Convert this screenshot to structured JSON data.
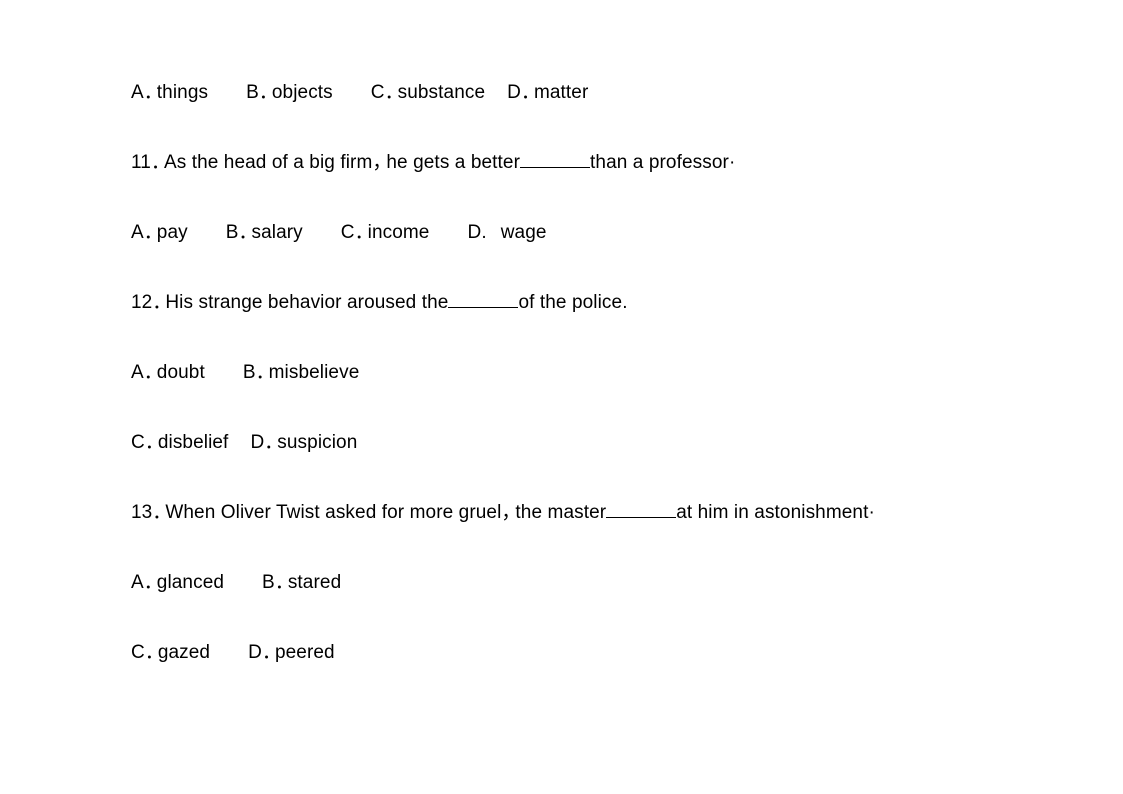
{
  "document": {
    "type": "vocabulary multiple choice exercise",
    "punctuation": {
      "wide_full_stop": "．",
      "wide_comma": "，",
      "middle_dot_terminator": "·",
      "period": "."
    },
    "lines": [
      {
        "id": "q10-options",
        "kind": "options",
        "options": [
          {
            "letter": "A",
            "text": "things"
          },
          {
            "letter": "B",
            "text": "objects"
          },
          {
            "letter": "C",
            "text": "substance"
          },
          {
            "letter": "D",
            "text": "matter"
          }
        ]
      },
      {
        "id": "q11-stem",
        "kind": "stem",
        "number": "11",
        "before_blank": "As the head of a big firm",
        "comma": "，",
        "mid": "he gets a better",
        "after_blank": "than a professor",
        "terminator": "·"
      },
      {
        "id": "q11-options",
        "kind": "options",
        "options": [
          {
            "letter": "A",
            "text": "pay"
          },
          {
            "letter": "B",
            "text": "salary"
          },
          {
            "letter": "C",
            "text": "income"
          },
          {
            "letter": "D",
            "text": "wage"
          }
        ]
      },
      {
        "id": "q12-stem",
        "kind": "stem",
        "number": "12",
        "before_blank": "His strange behavior aroused the",
        "after_blank": "of the police",
        "terminator": "."
      },
      {
        "id": "q12-options-ab",
        "kind": "options",
        "options": [
          {
            "letter": "A",
            "text": "doubt"
          },
          {
            "letter": "B",
            "text": "misbelieve"
          }
        ]
      },
      {
        "id": "q12-options-cd",
        "kind": "options",
        "options": [
          {
            "letter": "C",
            "text": "disbelief"
          },
          {
            "letter": "D",
            "text": "suspicion"
          }
        ]
      },
      {
        "id": "q13-stem",
        "kind": "stem",
        "number": "13",
        "before_blank": "When Oliver Twist asked for more gruel",
        "comma": "，",
        "mid": "the master",
        "after_blank": "at him in astonishment",
        "terminator": "·"
      },
      {
        "id": "q13-options-ab",
        "kind": "options",
        "options": [
          {
            "letter": "A",
            "text": "glanced"
          },
          {
            "letter": "B",
            "text": "stared"
          }
        ]
      },
      {
        "id": "q13-options-cd",
        "kind": "options",
        "options": [
          {
            "letter": "C",
            "text": "gazed"
          },
          {
            "letter": "D",
            "text": "peered"
          }
        ]
      }
    ]
  },
  "colors": {
    "page_background": "#ffffff",
    "text": "#000000",
    "blank_rule": "#000000"
  }
}
